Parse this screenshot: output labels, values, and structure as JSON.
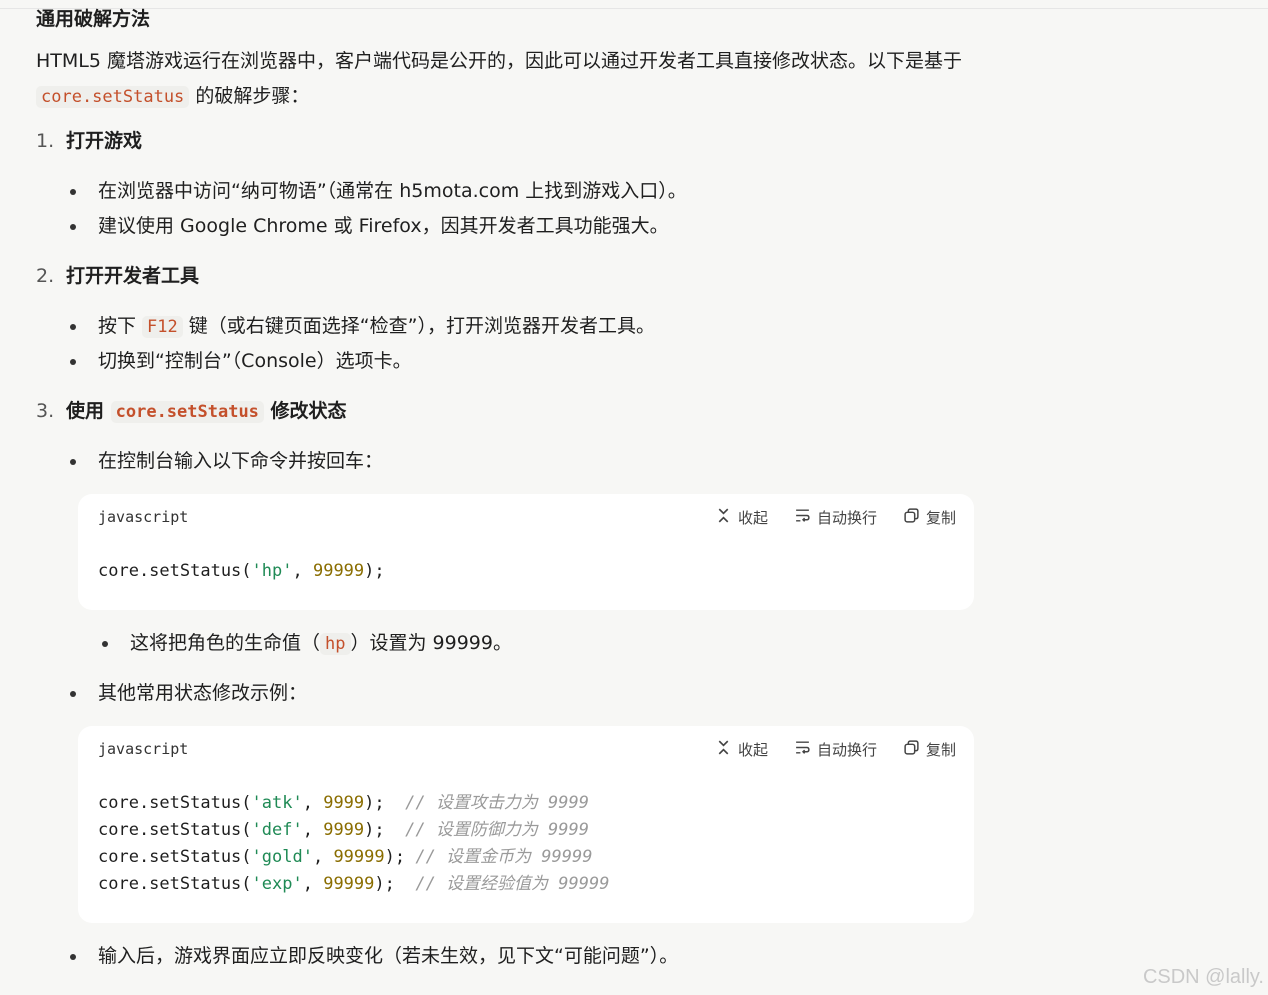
{
  "section_title": "通用破解方法",
  "intro": {
    "text_before": "HTML5 魔塔游戏运行在浏览器中，客户端代码是公开的，因此可以通过开发者工具直接修改状态。以下是基于 ",
    "code": "core.setStatus",
    "text_after": " 的破解步骤："
  },
  "steps": [
    {
      "number": "1.",
      "title": "打开游戏",
      "bullets": [
        "在浏览器中访问“纳可物语”（通常在 h5mota.com 上找到游戏入口）。",
        "建议使用 Google Chrome 或 Firefox，因其开发者工具功能强大。"
      ]
    },
    {
      "number": "2.",
      "title": "打开开发者工具",
      "bullet1_before": "按下 ",
      "bullet1_code": "F12",
      "bullet1_after": " 键（或右键页面选择“检查”），打开浏览器开发者工具。",
      "bullet2": "切换到“控制台”（Console）选项卡。"
    },
    {
      "number": "3.",
      "title_before": "使用 ",
      "title_code": "core.setStatus",
      "title_after": " 修改状态",
      "bullet1": "在控制台输入以下命令并按回车：",
      "sub_before": "这将把角色的生命值（",
      "sub_code": "hp",
      "sub_after": "）设置为 99999。",
      "bullet2": "其他常用状态修改示例：",
      "bullet3": "输入后，游戏界面应立即反映变化（若未生效，见下文“可能问题”）。"
    }
  ],
  "code_toolbar": {
    "collapse": "收起",
    "wrap": "自动换行",
    "copy": "复制"
  },
  "code_blocks": [
    {
      "language": "javascript",
      "lines": [
        {
          "fn": "core.setStatus(",
          "str": "'hp'",
          "sep": ", ",
          "num": "99999",
          "end": ");",
          "comment": ""
        }
      ]
    },
    {
      "language": "javascript",
      "lines": [
        {
          "fn": "core.setStatus(",
          "str": "'atk'",
          "sep": ", ",
          "num": "9999",
          "end": ");  ",
          "comment": "// 设置攻击力为 9999"
        },
        {
          "fn": "core.setStatus(",
          "str": "'def'",
          "sep": ", ",
          "num": "9999",
          "end": ");  ",
          "comment": "// 设置防御力为 9999"
        },
        {
          "fn": "core.setStatus(",
          "str": "'gold'",
          "sep": ", ",
          "num": "99999",
          "end": "); ",
          "comment": "// 设置金币为 99999"
        },
        {
          "fn": "core.setStatus(",
          "str": "'exp'",
          "sep": ", ",
          "num": "99999",
          "end": ");  ",
          "comment": "// 设置经验值为 99999"
        }
      ]
    }
  ],
  "watermark": "CSDN @lally."
}
